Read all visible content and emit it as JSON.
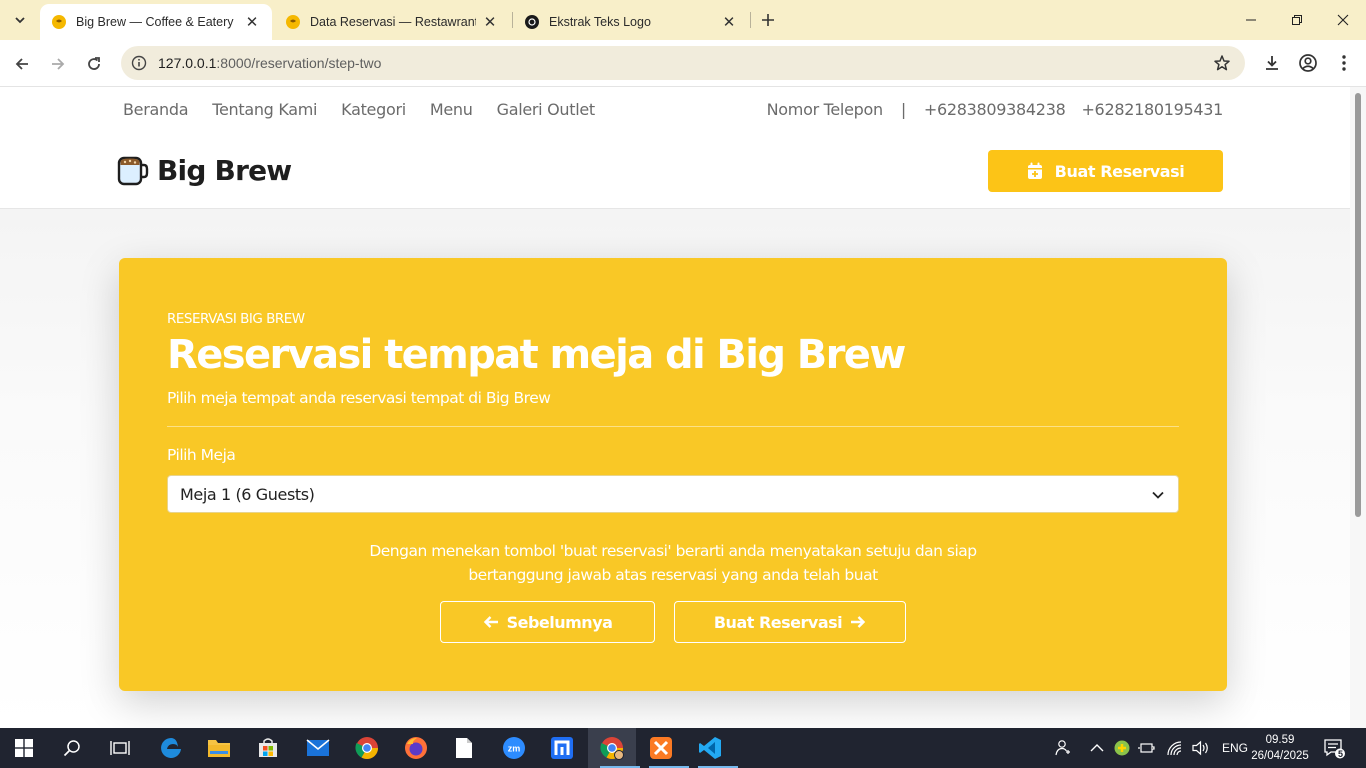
{
  "browser": {
    "tabs": [
      {
        "title": "Big Brew — Coffee & Eatery | R",
        "active": true
      },
      {
        "title": "Data Reservasi — Restawrant",
        "active": false
      },
      {
        "title": "Ekstrak Teks Logo",
        "active": false
      }
    ],
    "url_host": "127.0.0.1",
    "url_path": ":8000/reservation/step-two"
  },
  "header": {
    "nav": [
      "Beranda",
      "Tentang Kami",
      "Kategori",
      "Menu",
      "Galeri Outlet"
    ],
    "phone_label": "Nomor Telepon",
    "separator": "|",
    "phones": [
      "+6283809384238",
      "+6282180195431"
    ],
    "logo_text": "Big Brew",
    "cta_label": "Buat Reservasi"
  },
  "card": {
    "eyebrow": "RESERVASI BIG BREW",
    "title": "Reservasi tempat meja di Big Brew",
    "subtitle": "Pilih meja tempat anda reservasi tempat di Big Brew",
    "field_label": "Pilih Meja",
    "selected_table": "Meja 1 (6 Guests)",
    "terms_line1": "Dengan menekan tombol 'buat reservasi' berarti anda menyatakan setuju dan siap",
    "terms_line2": "bertanggung jawab atas reservasi yang anda telah buat",
    "prev_label": "Sebelumnya",
    "submit_label": "Buat Reservasi"
  },
  "colors": {
    "brand_yellow": "#f9c826",
    "cta_yellow": "#fcc417",
    "tabbar": "#f8efc9",
    "taskbar": "#202430"
  },
  "taskbar": {
    "language": "ENG",
    "time": "09.59",
    "date": "26/04/2025",
    "notifications": "5"
  }
}
